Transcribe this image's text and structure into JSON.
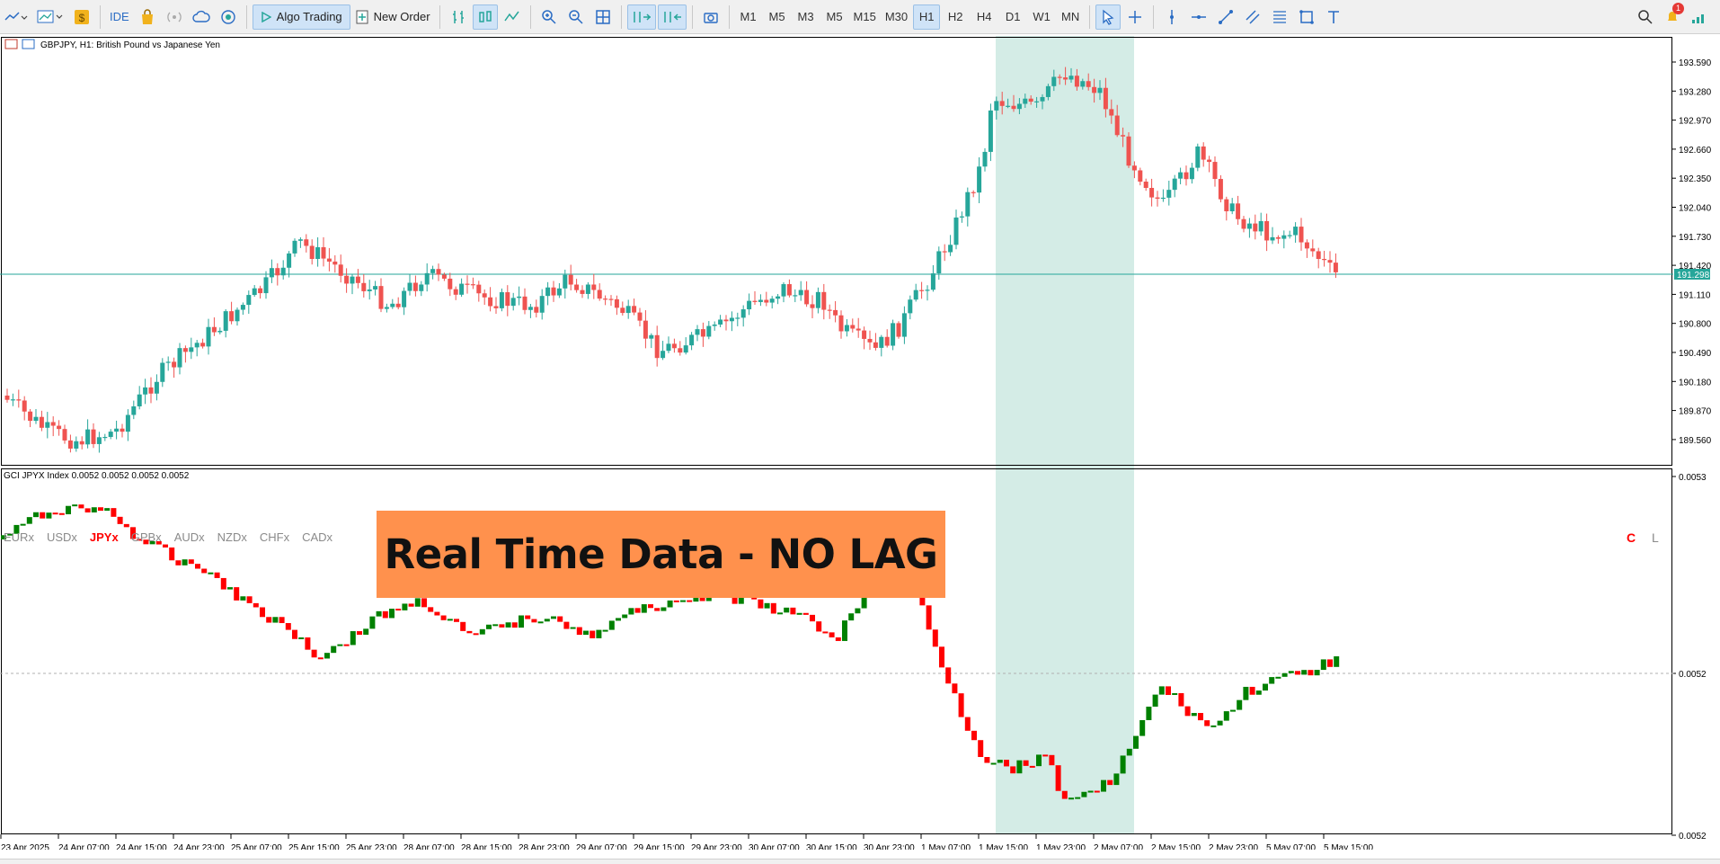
{
  "toolbar": {
    "ide_label": "IDE",
    "algo_label": "Algo Trading",
    "new_order_label": "New Order",
    "timeframes": [
      "M1",
      "M5",
      "M3",
      "M5",
      "M15",
      "M30",
      "H1",
      "H2",
      "H4",
      "D1",
      "W1",
      "MN"
    ],
    "active_timeframe": "H1",
    "notification_count": "1"
  },
  "chart": {
    "symbol_title": "GBPJPY, H1:  British Pound vs Japanese Yen",
    "current_price": "191.298",
    "price_ticks": [
      "193.590",
      "193.280",
      "192.970",
      "192.660",
      "192.350",
      "192.040",
      "191.730",
      "191.420",
      "191.110",
      "190.800",
      "190.490",
      "190.180",
      "189.870",
      "189.560"
    ],
    "up_color": "#26a69a",
    "down_color": "#ef5350",
    "highlight_color": "#d4ece6"
  },
  "indicator": {
    "title": "GCI JPYX Index 0.0052 0.0052 0.0052 0.0052",
    "ticks": [
      "0.0053",
      "0.0052",
      "0.0052"
    ],
    "currencies": [
      "EURx",
      "USDx",
      "JPYx",
      "GPBx",
      "AUDx",
      "NZDx",
      "CHFx",
      "CADx"
    ],
    "selected_currency": "JPYx",
    "mode_c": "C",
    "mode_l": "L",
    "up_color": "#008000",
    "down_color": "#ff0000"
  },
  "banner": {
    "text": "Real Time Data - NO LAG",
    "color": "#ff914d"
  },
  "time_axis": [
    "23 Apr 2025",
    "24 Apr 07:00",
    "24 Apr 15:00",
    "24 Apr 23:00",
    "25 Apr 07:00",
    "25 Apr 15:00",
    "25 Apr 23:00",
    "28 Apr 07:00",
    "28 Apr 15:00",
    "28 Apr 23:00",
    "29 Apr 07:00",
    "29 Apr 15:00",
    "29 Apr 23:00",
    "30 Apr 07:00",
    "30 Apr 15:00",
    "30 Apr 23:00",
    "1 May 07:00",
    "1 May 15:00",
    "1 May 23:00",
    "2 May 07:00",
    "2 May 15:00",
    "2 May 23:00",
    "5 May 07:00",
    "5 May 15:00"
  ]
}
